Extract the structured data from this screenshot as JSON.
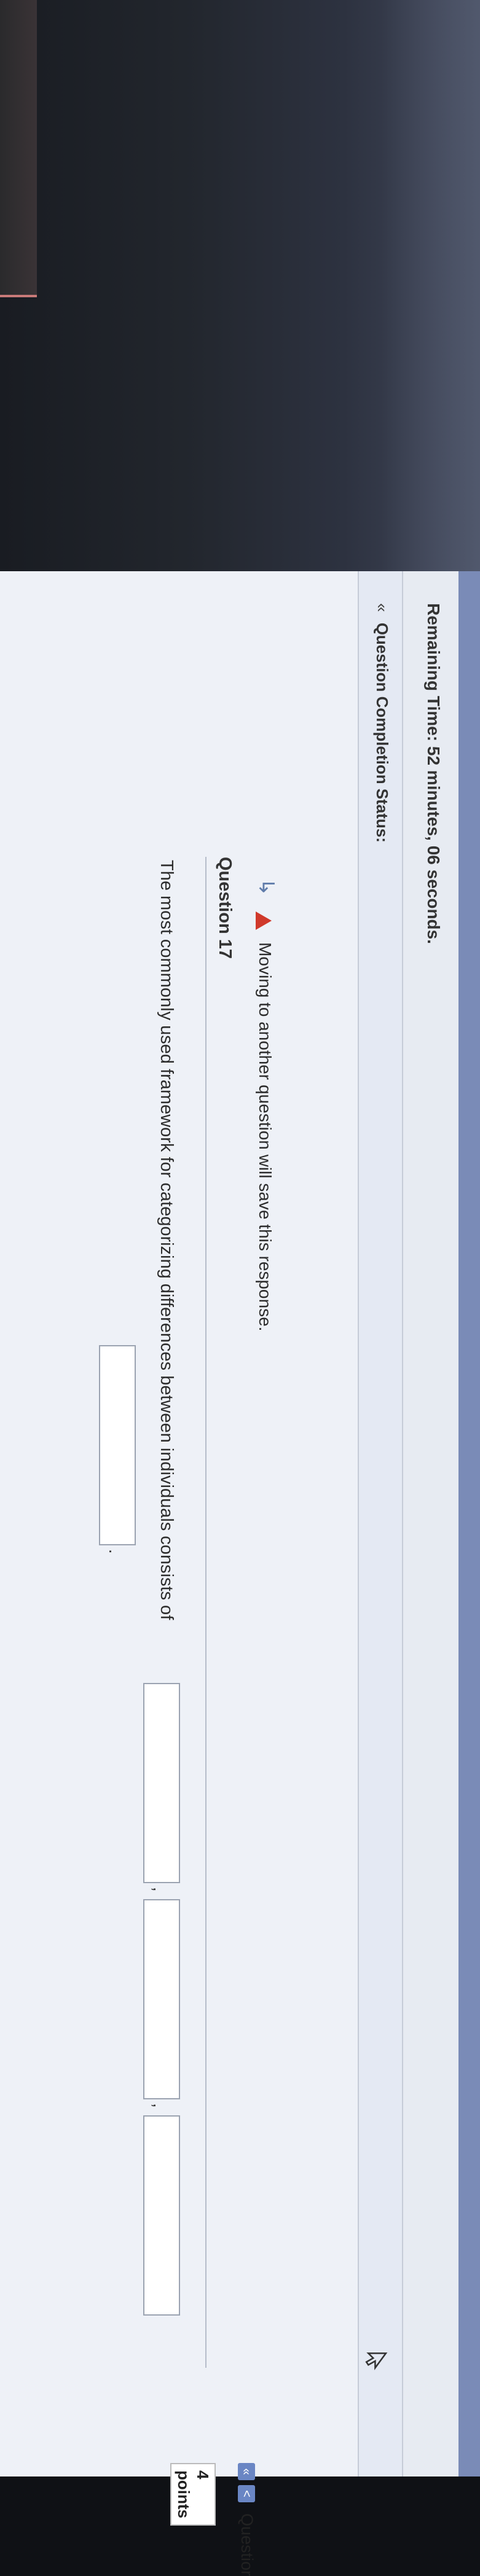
{
  "timer": {
    "label": "Remaining Time:",
    "value": "52 minutes, 06 seconds."
  },
  "completion": {
    "toggle": "«",
    "label": "Question Completion Status:"
  },
  "warning": {
    "text": "Moving to another question will save this response."
  },
  "question": {
    "title": "Question 17",
    "nav_label": "Questior",
    "nav_first": "«",
    "nav_prev": "<",
    "points": "4 points",
    "prompt": "The most commonly used framework for categorizing differences between individuals consists of",
    "separators": [
      ",",
      ",",
      "."
    ],
    "answers": [
      "",
      "",
      "",
      ""
    ]
  },
  "colors": {
    "accent": "#6a86c4",
    "warning": "#d0392b",
    "top_strip": "#7a8bb7"
  },
  "icons": [
    "arrow-right-icon",
    "warning-icon",
    "pointer-cursor-icon"
  ]
}
